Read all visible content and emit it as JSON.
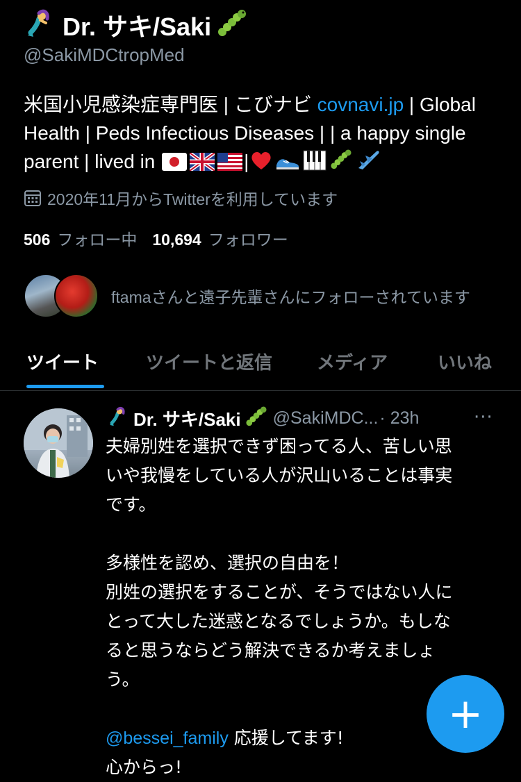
{
  "profile": {
    "display_name": "Dr. サキ/Saki",
    "handle": "@SakiMDCtropMed",
    "bio_prefix": "米国小児感染症専門医 | こびナビ ",
    "bio_link": "covnavi.jp",
    "bio_after_link": " | Global Health | Peds Infectious Diseases | | a happy single parent | lived in ",
    "bio_flags": [
      "🇯🇵",
      "🇬🇧",
      "🇺🇸"
    ],
    "bio_tail_emojis": [
      "❤️",
      "👟",
      "🎹",
      "🐛",
      "✈️"
    ],
    "joined": "2020年11月からTwitterを利用しています",
    "following_count": "506",
    "following_label": "フォロー中",
    "followers_count": "10,694",
    "followers_label": "フォロワー",
    "followed_by_text": "ftamaさんと遠子先輩さんにフォローされています"
  },
  "tabs": [
    {
      "label": "ツイート",
      "active": true
    },
    {
      "label": "ツイートと返信",
      "active": false
    },
    {
      "label": "メディア",
      "active": false
    },
    {
      "label": "いいね",
      "active": false
    }
  ],
  "tweet": {
    "author_name": "Dr. サキ/Saki",
    "author_handle": "@SakiMDC...",
    "time": "· 23h",
    "more": "···",
    "lines": [
      "夫婦別姓を選択できず困ってる人、苦しい思",
      "いや我慢をしている人が沢山いることは事実",
      "です。",
      "",
      "多様性を認め、選択の自由を！",
      "別姓の選択をすることが、そうではない人に",
      "とって大した迷惑となるでしょうか。もしな",
      "ると思うならどう解決できるか考えましょ",
      "う。",
      ""
    ],
    "mention": "@bessei_family",
    "mention_suffix": " 応援してます!",
    "last_line": "心からっ!"
  },
  "fab": {
    "label": "+"
  },
  "icons": {
    "name_left": "mermaid-icon",
    "name_right": "caterpillar-icon",
    "calendar": "calendar-icon"
  },
  "colors": {
    "accent": "#1d9bf0",
    "muted": "#8b98a5",
    "background": "#000000"
  }
}
